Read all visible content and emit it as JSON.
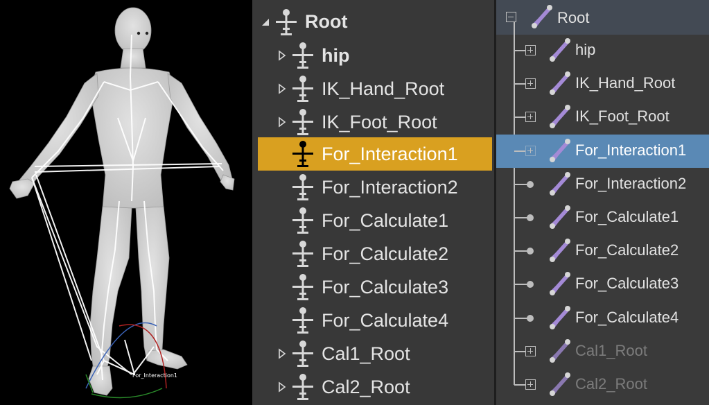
{
  "viewport": {
    "label": "For_Interaction1"
  },
  "panel_a": {
    "root_label": "Root",
    "items": [
      {
        "label": "hip",
        "bold": true,
        "expandable": true,
        "selected": false
      },
      {
        "label": "IK_Hand_Root",
        "bold": false,
        "expandable": true,
        "selected": false
      },
      {
        "label": "IK_Foot_Root",
        "bold": false,
        "expandable": true,
        "selected": false
      },
      {
        "label": "For_Interaction1",
        "bold": false,
        "expandable": false,
        "selected": true
      },
      {
        "label": "For_Interaction2",
        "bold": false,
        "expandable": false,
        "selected": false
      },
      {
        "label": "For_Calculate1",
        "bold": false,
        "expandable": false,
        "selected": false
      },
      {
        "label": "For_Calculate2",
        "bold": false,
        "expandable": false,
        "selected": false
      },
      {
        "label": "For_Calculate3",
        "bold": false,
        "expandable": false,
        "selected": false
      },
      {
        "label": "For_Calculate4",
        "bold": false,
        "expandable": false,
        "selected": false
      },
      {
        "label": "Cal1_Root",
        "bold": false,
        "expandable": true,
        "selected": false
      },
      {
        "label": "Cal2_Root",
        "bold": false,
        "expandable": true,
        "selected": false
      }
    ]
  },
  "panel_b": {
    "root_label": "Root",
    "items": [
      {
        "label": "hip",
        "node": "plus",
        "dim": false,
        "selected": false
      },
      {
        "label": "IK_Hand_Root",
        "node": "plus",
        "dim": false,
        "selected": false
      },
      {
        "label": "IK_Foot_Root",
        "node": "plus",
        "dim": false,
        "selected": false
      },
      {
        "label": "For_Interaction1",
        "node": "plus",
        "dim": false,
        "selected": true
      },
      {
        "label": "For_Interaction2",
        "node": "dot",
        "dim": false,
        "selected": false
      },
      {
        "label": "For_Calculate1",
        "node": "dot",
        "dim": false,
        "selected": false
      },
      {
        "label": "For_Calculate2",
        "node": "dot",
        "dim": false,
        "selected": false
      },
      {
        "label": "For_Calculate3",
        "node": "dot",
        "dim": false,
        "selected": false
      },
      {
        "label": "For_Calculate4",
        "node": "dot",
        "dim": false,
        "selected": false
      },
      {
        "label": "Cal1_Root",
        "node": "plus",
        "dim": true,
        "selected": false
      },
      {
        "label": "Cal2_Root",
        "node": "plus",
        "dim": true,
        "selected": false
      }
    ]
  },
  "colors": {
    "selection_a": "#d9a020",
    "selection_b": "#5a89b5",
    "bone_b": "#a48ad6"
  }
}
